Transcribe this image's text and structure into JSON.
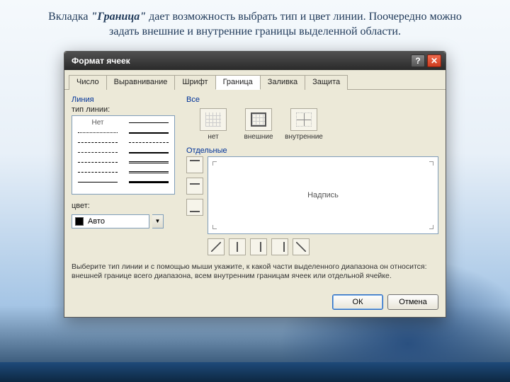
{
  "caption": {
    "pre": "Вкладка ",
    "em": "\"Граница\"",
    "post": " дает возможность выбрать тип и цвет линии. Поочередно можно задать внешние и внутренние границы выделенной области."
  },
  "dialog": {
    "title": "Формат ячеек",
    "tabs": [
      "Число",
      "Выравнивание",
      "Шрифт",
      "Граница",
      "Заливка",
      "Защита"
    ],
    "active_tab_index": 3,
    "line_group": "Линия",
    "line_type_label": "тип линии:",
    "line_none": "Нет",
    "color_label": "цвет:",
    "color_value": "Авто",
    "presets_group": "Все",
    "presets": [
      "нет",
      "внешние",
      "внутренние"
    ],
    "separate_group": "Отдельные",
    "preview_label": "Надпись",
    "hint": "Выберите тип линии и с помощью мыши укажите, к какой части выделенного диапазона он относится: внешней границе всего диапазона, всем внутренним границам ячеек или отдельной ячейке.",
    "ok": "ОК",
    "cancel": "Отмена"
  },
  "icons": {
    "help": "?",
    "close": "✕",
    "dropdown": "▼"
  },
  "line_styles": [
    {
      "name": "none"
    },
    {
      "css": "border-top:1.5px solid #000"
    },
    {
      "css": "border-top:1px dotted #000"
    },
    {
      "css": "border-top:2px solid #000"
    },
    {
      "css": "border-top:1px dashed #000"
    },
    {
      "css": "border-top:1px dashed #000;filter:contrast(1)"
    },
    {
      "css": "border-top:1px dashed #000;opacity:.9"
    },
    {
      "css": "border-top:2.5px solid #000"
    },
    {
      "css": "border-top:1px dashed #000"
    },
    {
      "css": "border-top:3px double #000"
    },
    {
      "css": "border-top:1px dashed #000"
    },
    {
      "css": "border-top:3px double #000"
    },
    {
      "css": "border-top:1px solid #000"
    },
    {
      "css": "border-top:3px solid #000"
    }
  ]
}
